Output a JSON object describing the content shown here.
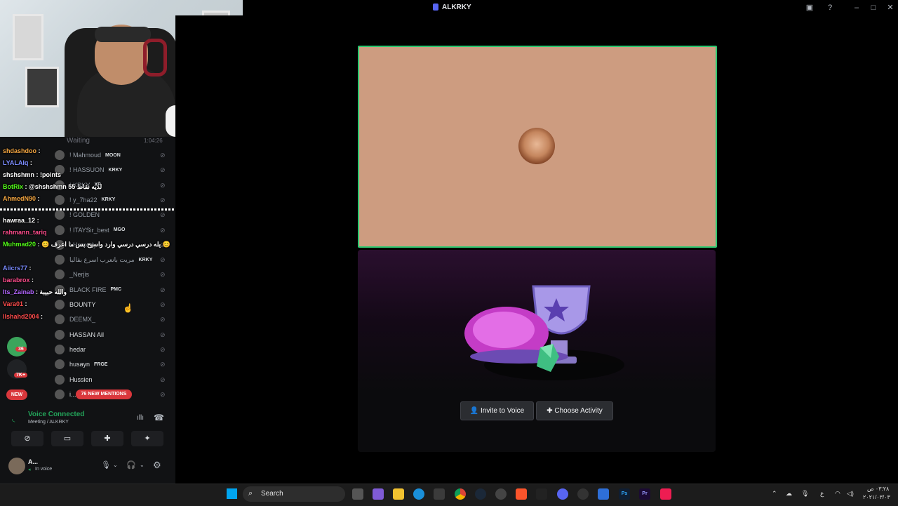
{
  "window": {
    "title": "ALKRKY",
    "controls": [
      "screen-share-icon",
      "help-icon",
      "minimize-icon",
      "maximize-icon",
      "close-icon"
    ]
  },
  "stream_overlay": {
    "status_text": "Waiting",
    "timer": "1:04:26",
    "chat": [
      {
        "user": "shdashdoo",
        "text": ":",
        "color": "#f5a742"
      },
      {
        "user": "LYALAIq",
        "text": ":",
        "color": "#7b8cff"
      },
      {
        "user": "shshshmn",
        "text": ": !points",
        "color": "#ffffff"
      },
      {
        "user": "BotRix",
        "text": ": @shshshmn 55 لديه نقاط",
        "color": "#53fc18"
      },
      {
        "user": "AhmedN90",
        "text": ":",
        "color": "#f5a742"
      },
      {
        "user": "hawraa_12",
        "text": ":",
        "color": "#ffffff"
      },
      {
        "user": "rahmann_tariq",
        "text": "",
        "color": "#ff4d8d"
      },
      {
        "user": "Muhmad20",
        "text": ": 😊 يله درسي درسي وارد واسيح بس ما اعرف 😊",
        "color": "#53fc18"
      },
      {
        "user": "Aiicrs77",
        "text": ":",
        "color": "#7b8cff"
      },
      {
        "user": "barabrox",
        "text": ":",
        "color": "#ff4d8d"
      },
      {
        "user": "Its_Zainab",
        "text": ": والله حبيبة",
        "color": "#b266ff"
      },
      {
        "user": "Vara01",
        "text": ":",
        "color": "#ff4d4d"
      },
      {
        "user": "llshahd2004",
        "text": ":",
        "color": "#ff4d4d"
      }
    ]
  },
  "members": [
    {
      "name": "! Mahmoud",
      "tag": "MOON",
      "dim": true
    },
    {
      "name": "! HASSUON",
      "tag": "KRKY",
      "dim": true
    },
    {
      "name": "! KRKY",
      "tag": "XP",
      "dim": true
    },
    {
      "name": "! y_7ha22",
      "tag": "KRKY",
      "dim": true
    },
    {
      "name": "! GOLDEN",
      "tag": "",
      "dim": true
    },
    {
      "name": "! ITAYSir_best",
      "tag": "MGO",
      "dim": true
    },
    {
      "name": "! Hmoody",
      "tag": "",
      "dim": true
    },
    {
      "name": "مريت بانعرب اسرع بقالبا",
      "tag": "KRKY",
      "dim": true
    },
    {
      "name": "_Nerjis",
      "tag": "",
      "dim": true
    },
    {
      "name": "BLACK FIRE",
      "tag": "PMC",
      "dim": true
    },
    {
      "name": "BOUNTY",
      "tag": "",
      "dim": false
    },
    {
      "name": "DEEMX_",
      "tag": "",
      "dim": true
    },
    {
      "name": "HASSAN Ail",
      "tag": "",
      "dim": false
    },
    {
      "name": "hedar",
      "tag": "",
      "dim": false
    },
    {
      "name": "husayn",
      "tag": "FRGE",
      "dim": false
    },
    {
      "name": "Hussien",
      "tag": "",
      "dim": false
    },
    {
      "name": "i...",
      "tag": "",
      "dim": false
    }
  ],
  "server_badges": {
    "badge1": "36",
    "badge2": "7K+",
    "badge3": "NEW"
  },
  "mentions_pill": "76 NEW MENTIONS",
  "voice": {
    "status": "Voice Connected",
    "channel": "Meeting / ALKRKY",
    "user_name": "A...",
    "user_status": "In voice"
  },
  "activity": {
    "invite_label": "Invite to Voice",
    "choose_label": "Choose Activity"
  },
  "taskbar": {
    "search_label": "Search",
    "time": "٠٣:٢٨ ص",
    "date": "٢٠٢١/٠٣/٠٣",
    "lang": "ع"
  },
  "colors": {
    "speaking_border": "#2dc770",
    "tile_bg": "#cd9c80",
    "voice_green": "#23a55a",
    "mention_red": "#da373c"
  }
}
